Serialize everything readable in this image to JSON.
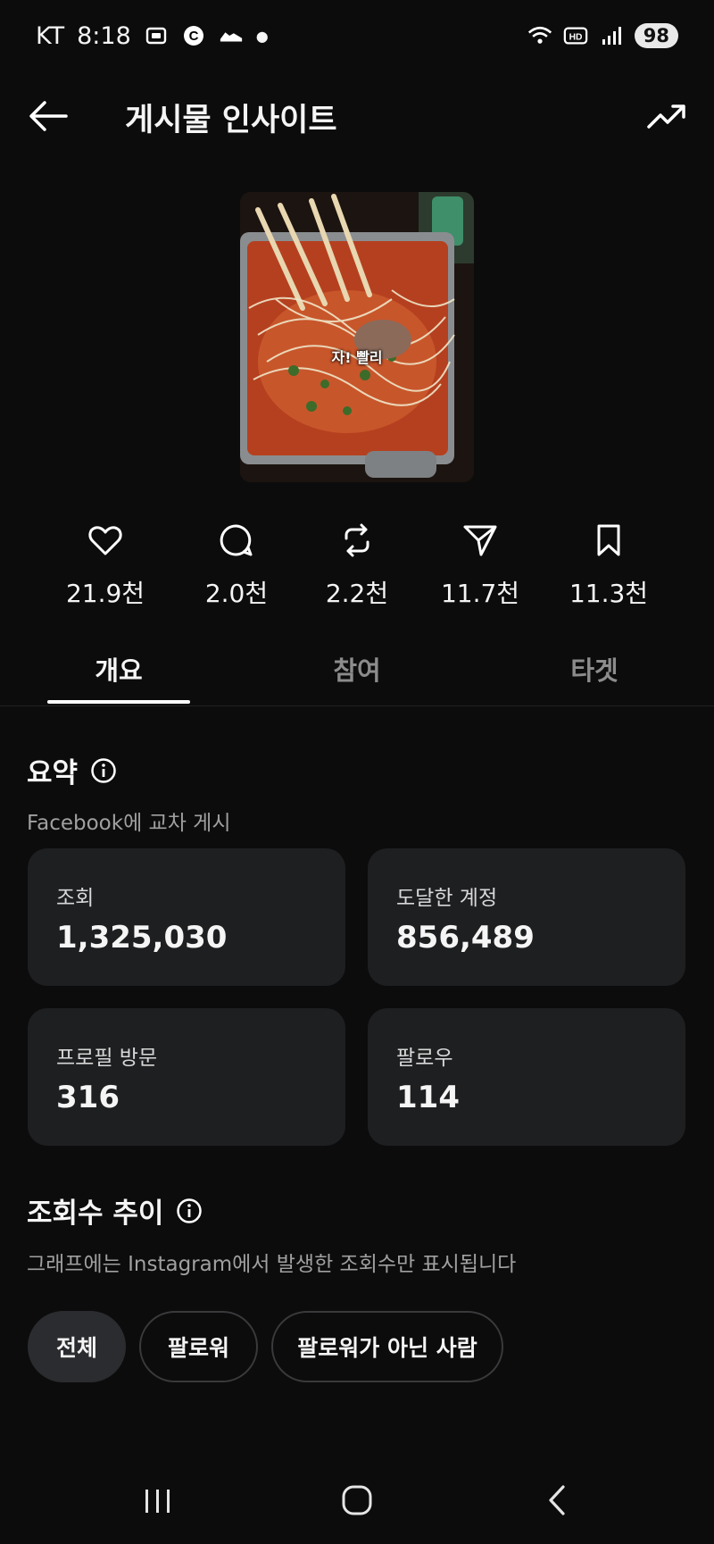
{
  "status_bar": {
    "carrier": "KT",
    "time": "8:18",
    "battery": "98"
  },
  "header": {
    "title": "게시물 인사이트"
  },
  "post": {
    "caption_overlay": "자! 빨리"
  },
  "engagement": [
    {
      "icon": "heart-icon",
      "value": "21.9천"
    },
    {
      "icon": "comment-icon",
      "value": "2.0천"
    },
    {
      "icon": "repost-icon",
      "value": "2.2천"
    },
    {
      "icon": "send-icon",
      "value": "11.7천"
    },
    {
      "icon": "bookmark-icon",
      "value": "11.3천"
    }
  ],
  "tabs": [
    {
      "label": "개요",
      "active": true
    },
    {
      "label": "참여",
      "active": false
    },
    {
      "label": "타겟",
      "active": false
    }
  ],
  "summary": {
    "title": "요약",
    "subtitle": "Facebook에 교차 게시",
    "cards": [
      {
        "label": "조회",
        "value": "1,325,030"
      },
      {
        "label": "도달한 계정",
        "value": "856,489"
      },
      {
        "label": "프로필 방문",
        "value": "316"
      },
      {
        "label": "팔로우",
        "value": "114"
      }
    ]
  },
  "views_trend": {
    "title": "조회수 추이",
    "subtitle": "그래프에는 Instagram에서 발생한 조회수만 표시됩니다",
    "filters": [
      {
        "label": "전체",
        "active": true
      },
      {
        "label": "팔로워",
        "active": false
      },
      {
        "label": "팔로워가 아닌 사람",
        "active": false
      }
    ]
  },
  "colors": {
    "background": "#0c0c0d",
    "card": "#1e1f21",
    "text": "#f5f5f5",
    "muted": "#a0a0a0"
  }
}
